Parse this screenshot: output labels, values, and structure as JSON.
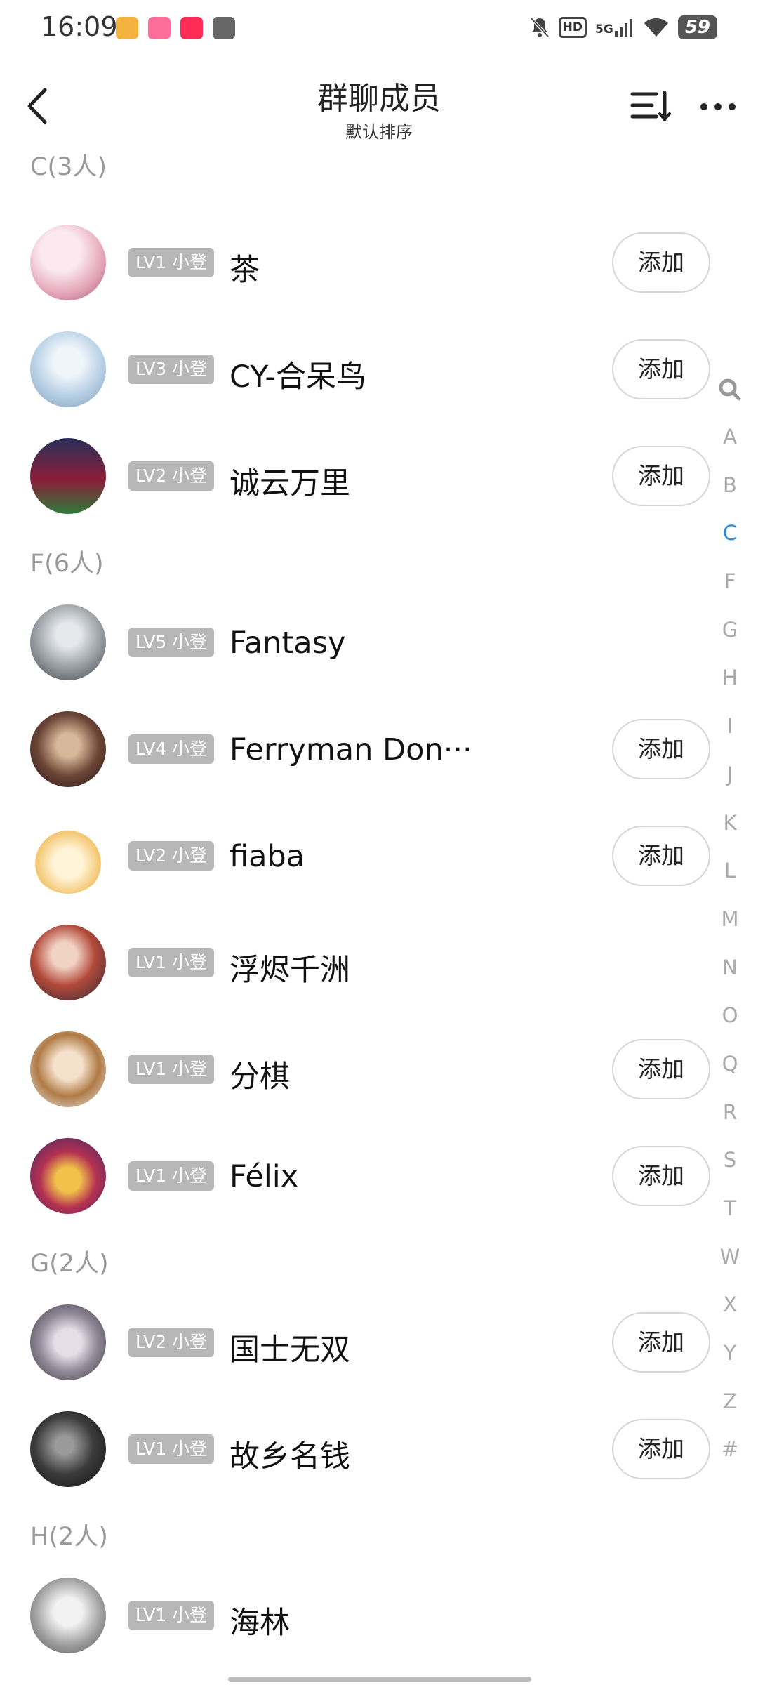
{
  "status_bar": {
    "time": "16:09",
    "network": "5G",
    "hd": "HD",
    "battery": "59",
    "icons": [
      "mute-bell-icon",
      "signal-icon",
      "wifi-icon",
      "battery-icon"
    ]
  },
  "header": {
    "title": "群聊成员",
    "subtitle": "默认排序",
    "icons": [
      "back-arrow-icon",
      "sort-icon",
      "more-icon"
    ]
  },
  "add_label": "添加",
  "sections": [
    {
      "header": "C(3人)",
      "members": [
        {
          "level": "LV1 小登",
          "name": "茶",
          "add": true,
          "avatar_color": "#f2d6de"
        },
        {
          "level": "LV3 小登",
          "name": "CY-合呆鸟",
          "add": true,
          "avatar_color": "#c9dced"
        },
        {
          "level": "LV2 小登",
          "name": "诚云万里",
          "add": true,
          "avatar_color": "#6e2233"
        }
      ]
    },
    {
      "header": "F(6人)",
      "members": [
        {
          "level": "LV5 小登",
          "name": "Fantasy",
          "add": false,
          "avatar_color": "#8d9296"
        },
        {
          "level": "LV4 小登",
          "name": "Ferryman Don···",
          "add": true,
          "avatar_color": "#4a3129"
        },
        {
          "level": "LV2 小登",
          "name": "fiaba",
          "add": true,
          "avatar_color": "#f3c56d"
        },
        {
          "level": "LV1 小登",
          "name": "浮烬千洲",
          "add": false,
          "avatar_color": "#7a3a34"
        },
        {
          "level": "LV1 小登",
          "name": "分棋",
          "add": true,
          "avatar_color": "#d9b58a"
        },
        {
          "level": "LV1 小登",
          "name": "Félix",
          "add": true,
          "avatar_color": "#8e1f3f"
        }
      ]
    },
    {
      "header": "G(2人)",
      "members": [
        {
          "level": "LV2 小登",
          "name": "国士无双",
          "add": true,
          "avatar_color": "#8f8896"
        },
        {
          "level": "LV1 小登",
          "name": "故乡名钱",
          "add": true,
          "avatar_color": "#303030"
        }
      ]
    },
    {
      "header": "H(2人)",
      "members": [
        {
          "level": "LV1 小登",
          "name": "海林",
          "add": false,
          "avatar_color": "#b8b8b8"
        }
      ]
    }
  ],
  "index_bar": {
    "letters": [
      "A",
      "B",
      "C",
      "F",
      "G",
      "H",
      "I",
      "J",
      "K",
      "L",
      "M",
      "N",
      "O",
      "Q",
      "R",
      "S",
      "T",
      "W",
      "X",
      "Y",
      "Z",
      "#"
    ],
    "active": "C"
  }
}
